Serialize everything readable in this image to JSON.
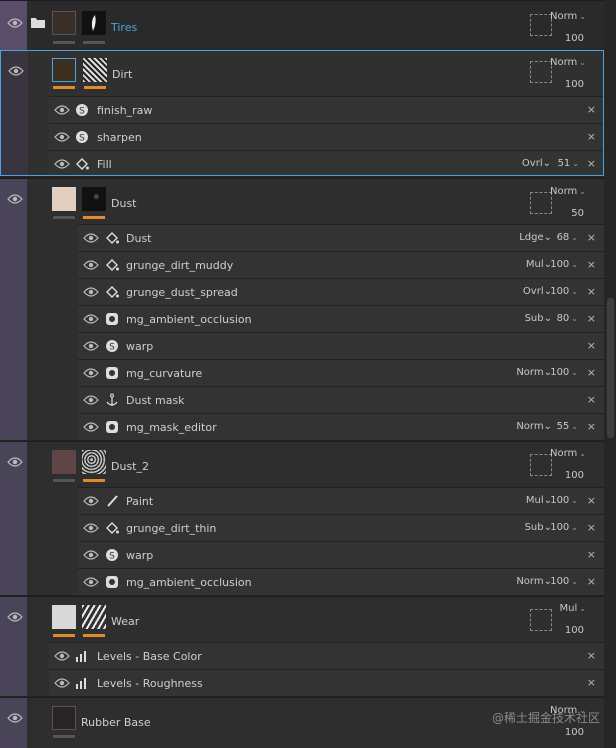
{
  "layers": {
    "tires": {
      "name": "Tires",
      "blend": "Norm",
      "opacity": "100"
    },
    "dirt": {
      "name": "Dirt",
      "blend": "Norm",
      "opacity": "100",
      "effects": [
        {
          "name": "finish_raw",
          "icon": "substance-icon"
        },
        {
          "name": "sharpen",
          "icon": "substance-icon"
        },
        {
          "name": "Fill",
          "icon": "fill-bucket-icon",
          "blend": "Ovrl",
          "opacity": "51"
        }
      ]
    },
    "dust": {
      "name": "Dust",
      "blend": "Norm",
      "opacity": "50",
      "effects": [
        {
          "name": "Dust",
          "icon": "fill-bucket-icon",
          "blend": "Ldge",
          "opacity": "68"
        },
        {
          "name": "grunge_dirt_muddy",
          "icon": "fill-bucket-icon",
          "blend": "Mul",
          "opacity": "100"
        },
        {
          "name": "grunge_dust_spread",
          "icon": "fill-bucket-icon",
          "blend": "Ovrl",
          "opacity": "100"
        },
        {
          "name": "mg_ambient_occlusion",
          "icon": "generator-icon",
          "blend": "Sub",
          "opacity": "80"
        },
        {
          "name": "warp",
          "icon": "substance-icon"
        },
        {
          "name": "mg_curvature",
          "icon": "generator-icon",
          "blend": "Norm",
          "opacity": "100"
        },
        {
          "name": "Dust mask",
          "icon": "anchor-icon"
        },
        {
          "name": "mg_mask_editor",
          "icon": "generator-icon",
          "blend": "Norm",
          "opacity": "55"
        }
      ]
    },
    "dust2": {
      "name": "Dust_2",
      "blend": "Norm",
      "opacity": "100",
      "effects": [
        {
          "name": "Paint",
          "icon": "brush-icon",
          "blend": "Mul",
          "opacity": "100"
        },
        {
          "name": "grunge_dirt_thin",
          "icon": "fill-bucket-icon",
          "blend": "Sub",
          "opacity": "100"
        },
        {
          "name": "warp",
          "icon": "substance-icon"
        },
        {
          "name": "mg_ambient_occlusion",
          "icon": "generator-icon",
          "blend": "Norm",
          "opacity": "100"
        }
      ]
    },
    "wear": {
      "name": "Wear",
      "blend": "Mul",
      "opacity": "100",
      "effects": [
        {
          "name": "Levels - Base Color",
          "icon": "levels-icon"
        },
        {
          "name": "Levels - Roughness",
          "icon": "levels-icon"
        }
      ]
    },
    "rubber": {
      "name": "Rubber Base",
      "blend": "Norm",
      "opacity": "100"
    }
  },
  "watermark": "@稀土掘金技术社区",
  "colors": {
    "accent": "#e08a2c",
    "selection": "#4aa3df",
    "folder_name": "#4aa3df",
    "stripe": "#4a4458"
  }
}
